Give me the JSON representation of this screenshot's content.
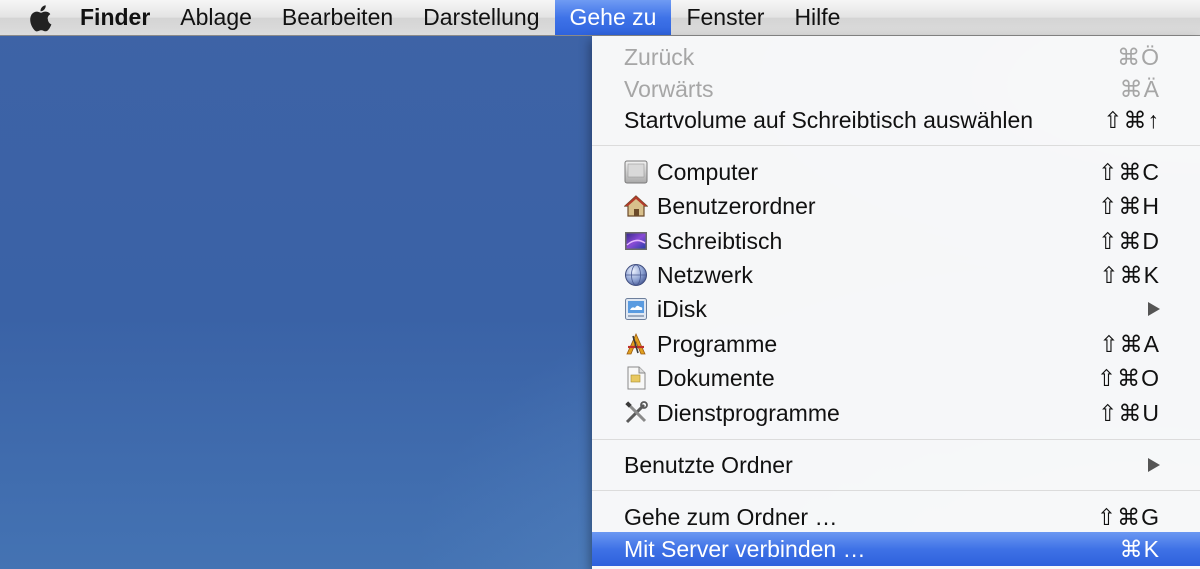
{
  "menubar": {
    "items": [
      {
        "label": "Finder"
      },
      {
        "label": "Ablage"
      },
      {
        "label": "Bearbeiten"
      },
      {
        "label": "Darstellung"
      },
      {
        "label": "Gehe zu"
      },
      {
        "label": "Fenster"
      },
      {
        "label": "Hilfe"
      }
    ],
    "apple_icon": "apple-logo-icon"
  },
  "menu": {
    "group1": [
      {
        "label": "Zurück",
        "shortcut": "⌘Ö",
        "enabled": false
      },
      {
        "label": "Vorwärts",
        "shortcut": "⌘Ä",
        "enabled": false
      },
      {
        "label": "Startvolume auf Schreibtisch auswählen",
        "shortcut": "⇧⌘↑",
        "enabled": true
      }
    ],
    "group2": [
      {
        "label": "Computer",
        "shortcut": "⇧⌘C",
        "icon": "computer-icon"
      },
      {
        "label": "Benutzerordner",
        "shortcut": "⇧⌘H",
        "icon": "home-icon"
      },
      {
        "label": "Schreibtisch",
        "shortcut": "⇧⌘D",
        "icon": "desktop-icon"
      },
      {
        "label": "Netzwerk",
        "shortcut": "⇧⌘K",
        "icon": "network-icon"
      },
      {
        "label": "iDisk",
        "shortcut": "",
        "icon": "idisk-icon",
        "submenu": true
      },
      {
        "label": "Programme",
        "shortcut": "⇧⌘A",
        "icon": "applications-icon"
      },
      {
        "label": "Dokumente",
        "shortcut": "⇧⌘O",
        "icon": "documents-icon"
      },
      {
        "label": "Dienstprogramme",
        "shortcut": "⇧⌘U",
        "icon": "utilities-icon"
      }
    ],
    "group3": [
      {
        "label": "Benutzte Ordner",
        "submenu": true
      }
    ],
    "group4": [
      {
        "label": "Gehe zum Ordner …",
        "shortcut": "⇧⌘G"
      },
      {
        "label": "Mit Server verbinden …",
        "shortcut": "⌘K",
        "highlighted": true
      }
    ]
  },
  "colors": {
    "highlight": "#3f72e6",
    "desktop": "#3e63a6",
    "disabled_text": "#a6a6a6"
  }
}
